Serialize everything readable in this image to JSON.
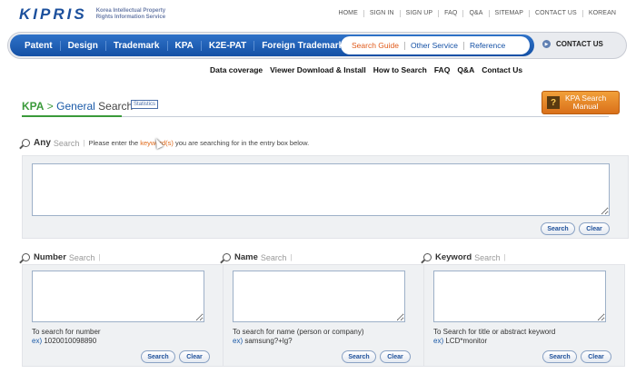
{
  "brand": {
    "logo": "KIPRIS",
    "tagline_line1": "Korea Intellectual Property",
    "tagline_line2": "Rights Information Service"
  },
  "utility_nav": [
    "HOME",
    "SIGN IN",
    "SIGN UP",
    "FAQ",
    "Q&A",
    "SITEMAP",
    "CONTACT US",
    "KOREAN"
  ],
  "main_nav": [
    "Patent",
    "Design",
    "Trademark",
    "KPA",
    "K2E-PAT",
    "Foreign Trademark"
  ],
  "service_nav": [
    "Search Guide",
    "Other Service",
    "Reference"
  ],
  "contact_label": "CONTACT US",
  "sub_links": [
    "Data coverage",
    "Viewer Download & Install",
    "How to Search",
    "FAQ",
    "Q&A",
    "Contact Us"
  ],
  "title": {
    "kpa": "KPA",
    "sep": " > ",
    "general": "General",
    "search": " Search",
    "statistics": "Statistics"
  },
  "manual_button": {
    "line1": "KPA Search",
    "line2": "Manual",
    "icon": "?"
  },
  "any_search": {
    "label_bold": "Any",
    "label_light": "Search",
    "bar": "|",
    "hint_before": "Please enter the ",
    "hint_highlight": "keyword(s)",
    "hint_after": " you are searching for in the entry box below."
  },
  "buttons": {
    "search": "Search",
    "clear": "Clear"
  },
  "panels": [
    {
      "label_bold": "Number",
      "label_light": "Search",
      "bar": "|",
      "description": "To search for number",
      "example_prefix": "ex)",
      "example_value": " 1020010098890"
    },
    {
      "label_bold": "Name",
      "label_light": "Search",
      "bar": "|",
      "description": "To search for name (person or company)",
      "example_prefix": "ex)",
      "example_value": " samsung?+lg?"
    },
    {
      "label_bold": "Keyword",
      "label_light": "Search",
      "bar": "|",
      "description": "To Search for title or abstract keyword",
      "example_prefix": "ex)",
      "example_value": " LCD*monitor"
    }
  ],
  "colors": {
    "nav_blue": "#1450a5",
    "accent_orange": "#e05a1a",
    "title_green": "#3a9a3a",
    "panel_bg": "#eff1f3"
  }
}
